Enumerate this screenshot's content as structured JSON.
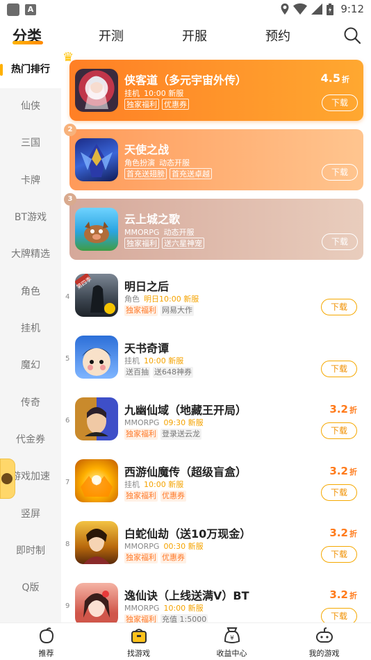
{
  "status_bar": {
    "time": "9:12",
    "left_icon_letter": "A"
  },
  "top_tabs": [
    {
      "label": "分类",
      "active": true
    },
    {
      "label": "开测",
      "active": false
    },
    {
      "label": "开服",
      "active": false
    },
    {
      "label": "预约",
      "active": false
    }
  ],
  "sidebar": [
    {
      "label": "热门排行",
      "active": true
    },
    {
      "label": "仙侠"
    },
    {
      "label": "三国"
    },
    {
      "label": "卡牌"
    },
    {
      "label": "BT游戏"
    },
    {
      "label": "大牌精选"
    },
    {
      "label": "角色"
    },
    {
      "label": "挂机"
    },
    {
      "label": "魔幻"
    },
    {
      "label": "传奇"
    },
    {
      "label": "代金券"
    },
    {
      "label": "游戏加速"
    },
    {
      "label": "竖屏"
    },
    {
      "label": "即时制"
    },
    {
      "label": "Q版"
    }
  ],
  "featured": [
    {
      "rank": "1",
      "title": "侠客道（多元宇宙外传）",
      "category": "挂机",
      "time": "10:00 新服",
      "tags": [
        "独家福利",
        "优惠券"
      ],
      "discount": "4.5",
      "discount_unit": "折",
      "download": "下载"
    },
    {
      "rank": "2",
      "title": "天使之战",
      "category": "角色扮演",
      "time": "动态开服",
      "tags": [
        "首充送翅膀",
        "首充送卓越"
      ],
      "discount": "",
      "discount_unit": "",
      "download": "下载"
    },
    {
      "rank": "3",
      "title": "云上城之歌",
      "category": "MMORPG",
      "time": "动态开服",
      "tags": [
        "独家福利",
        "送六星神宠"
      ],
      "discount": "",
      "discount_unit": "",
      "download": "下载"
    }
  ],
  "games": [
    {
      "rank": "4",
      "title": "明日之后",
      "category": "角色",
      "time": "明日10:00 新服",
      "tags": [
        {
          "text": "独家福利",
          "hot": true
        },
        {
          "text": "网易大作",
          "hot": false
        }
      ],
      "discount": "",
      "discount_unit": "",
      "download": "下载",
      "badge": "第四季"
    },
    {
      "rank": "5",
      "title": "天书奇谭",
      "category": "挂机",
      "time": "10:00 新服",
      "tags": [
        {
          "text": "送百抽",
          "hot": false
        },
        {
          "text": "送648神券",
          "hot": false
        }
      ],
      "discount": "",
      "discount_unit": "",
      "download": "下载"
    },
    {
      "rank": "6",
      "title": "九幽仙域（地藏王开局）",
      "category": "MMORPG",
      "time": "09:30 新服",
      "tags": [
        {
          "text": "独家福利",
          "hot": true
        },
        {
          "text": "登录送云龙",
          "hot": false
        }
      ],
      "discount": "3.2",
      "discount_unit": "折",
      "download": "下载"
    },
    {
      "rank": "7",
      "title": "西游仙魔传（超级盲盒）",
      "category": "挂机",
      "time": "10:00 新服",
      "tags": [
        {
          "text": "独家福利",
          "hot": true
        },
        {
          "text": "优惠券",
          "hot": true
        }
      ],
      "discount": "3.2",
      "discount_unit": "折",
      "download": "下载"
    },
    {
      "rank": "8",
      "title": "白蛇仙劫（送10万现金）",
      "category": "MMORPG",
      "time": "00:30 新服",
      "tags": [
        {
          "text": "独家福利",
          "hot": true
        },
        {
          "text": "优惠券",
          "hot": true
        }
      ],
      "discount": "3.2",
      "discount_unit": "折",
      "download": "下载"
    },
    {
      "rank": "9",
      "title": "逸仙诀（上线送满V）BT",
      "category": "MMORPG",
      "time": "10:00 新服",
      "tags": [
        {
          "text": "独家福利",
          "hot": true
        },
        {
          "text": "充值 1:5000",
          "hot": false
        }
      ],
      "discount": "3.2",
      "discount_unit": "折",
      "download": "下载"
    }
  ],
  "bottom_nav": [
    {
      "label": "推荐",
      "icon": "recommend-icon"
    },
    {
      "label": "找游戏",
      "icon": "find-game-icon",
      "active": true
    },
    {
      "label": "收益中心",
      "icon": "earnings-icon"
    },
    {
      "label": "我的游戏",
      "icon": "gamepad-icon"
    }
  ],
  "colors": {
    "accent": "#ffb000",
    "discount": "#ff7a1a",
    "card1": "#ff8a2a",
    "card2": "#ffa66b",
    "card3": "#ddb6a6"
  }
}
